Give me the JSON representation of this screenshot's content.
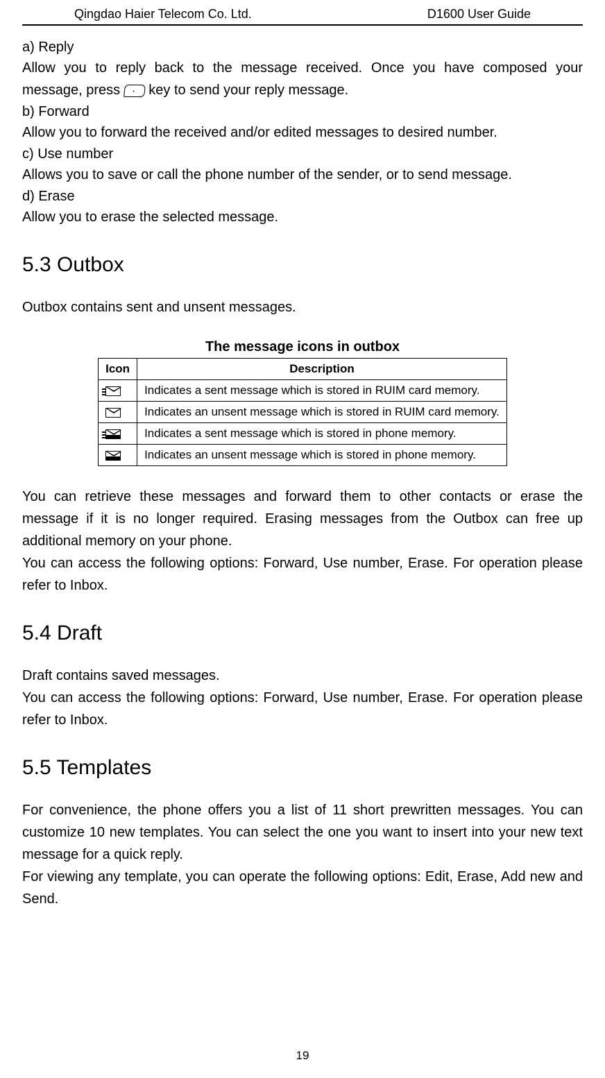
{
  "header": {
    "left": "Qingdao Haier Telecom Co. Ltd.",
    "right": "D1600 User Guide"
  },
  "section_a": {
    "heading": "a) Reply",
    "text_before_key": "Allow you to reply back to the message received. Once you have composed your message, press ",
    "text_after_key": " key to send your reply message."
  },
  "section_b": {
    "heading": "b) Forward",
    "text": "Allow you to forward the received and/or edited messages to desired number."
  },
  "section_c": {
    "heading": "c) Use number",
    "text": "Allows you to save or call the phone number of the sender, or to send message."
  },
  "section_d": {
    "heading": "d) Erase",
    "text": "Allow you to erase the selected message."
  },
  "outbox": {
    "heading": "5.3 Outbox",
    "intro": "Outbox contains sent and unsent messages.",
    "table_title": "The message icons in outbox",
    "table_headers": {
      "icon": "Icon",
      "description": "Description"
    },
    "rows": [
      {
        "description": "Indicates a sent message which is stored in RUIM card memory."
      },
      {
        "description": "Indicates an unsent message which is stored in RUIM card memory."
      },
      {
        "description": "Indicates a sent message which is stored in phone memory."
      },
      {
        "description": "Indicates an unsent message which is stored in phone memory."
      }
    ],
    "para1": "You can retrieve these messages and forward them to other contacts or erase the message if it is no longer required. Erasing messages from the Outbox can free up additional memory on your phone.",
    "para2": "You can access the following options: Forward, Use number, Erase. For operation please refer to Inbox."
  },
  "draft": {
    "heading": "5.4 Draft",
    "para1": "Draft contains saved messages.",
    "para2": "You can access the following options: Forward, Use number, Erase. For operation please refer to Inbox."
  },
  "templates": {
    "heading": "5.5 Templates",
    "para1": "For convenience, the phone offers you a list of 11 short prewritten messages. You can customize 10 new templates. You can select the one you want to insert into your new text message for a quick reply.",
    "para2": "For viewing any template, you can operate the following options: Edit, Erase, Add new and Send."
  },
  "page_number": "19"
}
